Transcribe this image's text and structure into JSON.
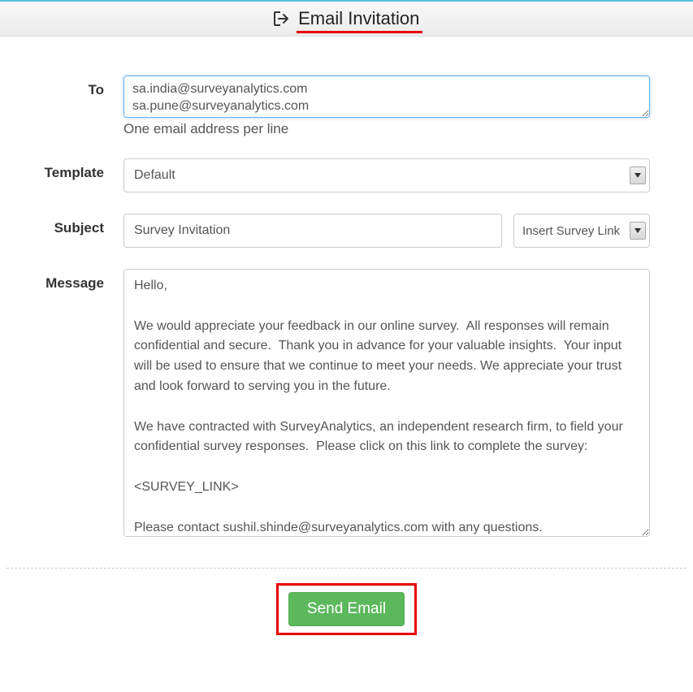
{
  "header": {
    "title": "Email Invitation"
  },
  "form": {
    "to": {
      "label": "To",
      "value": "sa.india@surveyanalytics.com\nsa.pune@surveyanalytics.com",
      "help": "One email address per line"
    },
    "template": {
      "label": "Template",
      "selected": "Default"
    },
    "subject": {
      "label": "Subject",
      "value": "Survey Invitation",
      "insert_link_label": "Insert Survey Link"
    },
    "message": {
      "label": "Message",
      "value": "Hello,\n\nWe would appreciate your feedback in our online survey.  All responses will remain confidential and secure.  Thank you in advance for your valuable insights.  Your input will be used to ensure that we continue to meet your needs. We appreciate your trust and look forward to serving you in the future.\n\nWe have contracted with SurveyAnalytics, an independent research firm, to field your confidential survey responses.  Please click on this link to complete the survey:\n\n<SURVEY_LINK>\n\nPlease contact sushil.shinde@surveyanalytics.com with any questions."
    }
  },
  "footer": {
    "send_label": "Send Email"
  }
}
